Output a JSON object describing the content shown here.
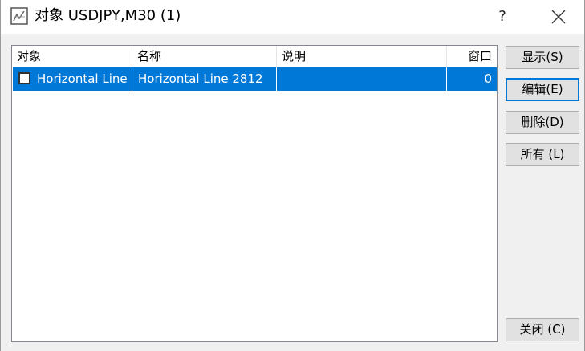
{
  "window": {
    "title": "对象 USDJPY,M30 (1)",
    "help_label": "?",
    "icon": "object-list-icon",
    "close_icon": "close-icon"
  },
  "columns": [
    {
      "label": "对象"
    },
    {
      "label": "名称"
    },
    {
      "label": "说明"
    },
    {
      "label": "窗口"
    }
  ],
  "rows": [
    {
      "checked": false,
      "object": "Horizontal Line",
      "name": "Horizontal Line 2812",
      "description": "",
      "window": "0"
    }
  ],
  "buttons": {
    "show": "显示(S)",
    "edit": "编辑(E)",
    "delete": "删除(D)",
    "all": "所有 (L)",
    "close": "关闭 (C)"
  },
  "colors": {
    "selection": "#0078d7",
    "titlebar": "#ffffff",
    "background": "#f0f0f0"
  }
}
